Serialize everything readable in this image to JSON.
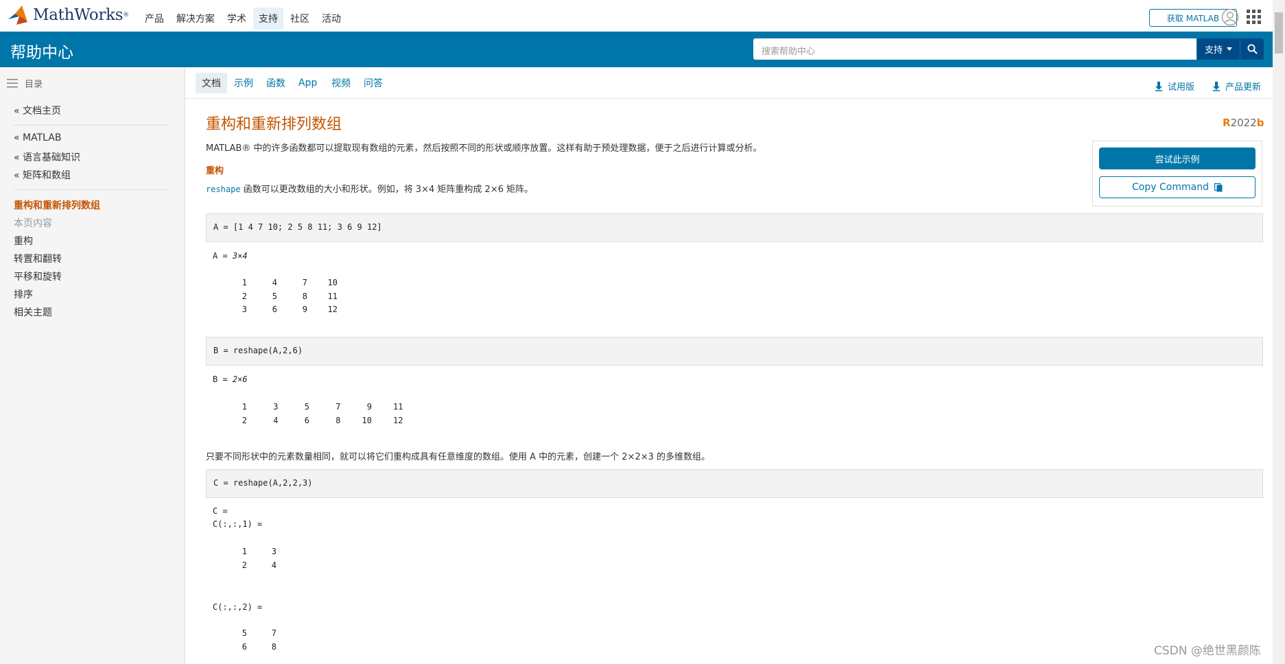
{
  "brand": {
    "name": "MathWorks",
    "reg": "®"
  },
  "topnav": [
    "产品",
    "解决方案",
    "学术",
    "支持",
    "社区",
    "活动"
  ],
  "topnav_active": "支持",
  "get_matlab": "获取 MATLAB",
  "header": {
    "title": "帮助中心",
    "search_placeholder": "搜索帮助中心",
    "support": "支持"
  },
  "sidebar": {
    "toc_label": "目录",
    "home": "« 文档主页",
    "crumbs": [
      "« MATLAB",
      "« 语言基础知识",
      "« 矩阵和数组"
    ],
    "current": "重构和重新排列数组",
    "on_page": "本页内容",
    "sections": [
      "重构",
      "转置和翻转",
      "平移和旋转",
      "排序",
      "相关主题"
    ]
  },
  "subtabs": [
    "文档",
    "示例",
    "函数",
    "App",
    "视频",
    "问答"
  ],
  "subtab_active": "文档",
  "right_links": {
    "trial": "试用版",
    "updates": "产品更新"
  },
  "page": {
    "title": "重构和重新排列数组",
    "release_prefix": "R",
    "release_year": "2022",
    "release_suffix": "b",
    "intro": "MATLAB® 中的许多函数都可以提取现有数组的元素，然后按照不同的形状或顺序放置。这样有助于预处理数据，便于之后进行计算或分析。",
    "section_reshape": "重构",
    "reshape_code": "reshape",
    "reshape_text": " 函数可以更改数组的大小和形状。例如，将 3×4 矩阵重构成 2×6 矩阵。",
    "para2": "只要不同形状中的元素数量相同，就可以将它们重构成具有任意维度的数组。使用 A 中的元素，创建一个 2×2×3 的多维数组。"
  },
  "try_panel": {
    "try_label": "尝试此示例",
    "copy_label": "Copy Command"
  },
  "code": {
    "a_cmd": "A = [1 4 7 10; 2 5 8 11; 3 6 9 12]",
    "a_out_label": "A = ",
    "a_out_size": "3×4",
    "a_matrix": [
      [
        "1",
        "4",
        "7",
        "10"
      ],
      [
        "2",
        "5",
        "8",
        "11"
      ],
      [
        "3",
        "6",
        "9",
        "12"
      ]
    ],
    "b_cmd": "B = reshape(A,2,6)",
    "b_out_label": "B = ",
    "b_out_size": "2×6",
    "b_matrix": [
      [
        "1",
        "3",
        "5",
        "7",
        "9",
        "11"
      ],
      [
        "2",
        "4",
        "6",
        "8",
        "10",
        "12"
      ]
    ],
    "c_cmd": "C = reshape(A,2,2,3)",
    "c_out_label": "C = ",
    "c_page1": "C(:,:,1) =",
    "c1_matrix": [
      [
        "1",
        "3"
      ],
      [
        "2",
        "4"
      ]
    ],
    "c_page2": "C(:,:,2) =",
    "c2_matrix": [
      [
        "5",
        "7"
      ],
      [
        "6",
        "8"
      ]
    ]
  },
  "watermark": "CSDN @绝世黑颜陈",
  "colors": {
    "brand_blue": "#0076a8",
    "title_orange": "#c45400",
    "dark_blue": "#004b87"
  }
}
